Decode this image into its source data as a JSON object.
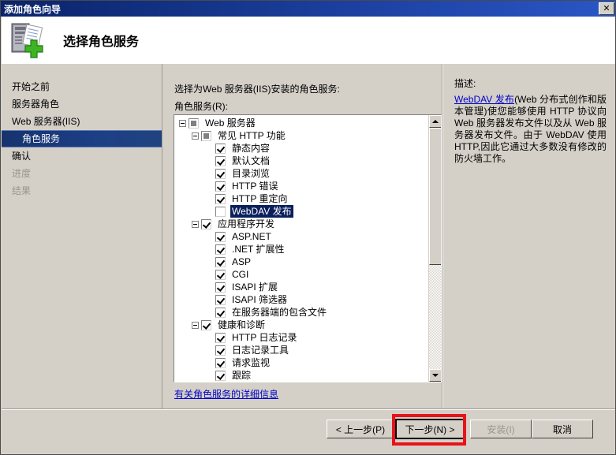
{
  "window": {
    "title": "添加角色向导",
    "close_label": "✕"
  },
  "header": {
    "title": "选择角色服务",
    "icon": "server-add-icon"
  },
  "sidebar": {
    "items": [
      {
        "label": "开始之前",
        "state": "normal",
        "indent": 0
      },
      {
        "label": "服务器角色",
        "state": "normal",
        "indent": 0
      },
      {
        "label": "Web 服务器(IIS)",
        "state": "normal",
        "indent": 0
      },
      {
        "label": "角色服务",
        "state": "selected",
        "indent": 1
      },
      {
        "label": "确认",
        "state": "normal",
        "indent": 0
      },
      {
        "label": "进度",
        "state": "disabled",
        "indent": 0
      },
      {
        "label": "结果",
        "state": "disabled",
        "indent": 0
      }
    ]
  },
  "main": {
    "instruction": "选择为Web 服务器(IIS)安装的角色服务:",
    "field_label": "角色服务(R):",
    "more_link": "有关角色服务的详细信息",
    "tree": [
      {
        "label": "Web 服务器",
        "indent": 0,
        "toggle": "expanded",
        "check": "partial",
        "selected": false
      },
      {
        "label": "常见 HTTP 功能",
        "indent": 1,
        "toggle": "expanded",
        "check": "partial",
        "selected": false
      },
      {
        "label": "静态内容",
        "indent": 2,
        "toggle": "none",
        "check": "checked",
        "selected": false
      },
      {
        "label": "默认文档",
        "indent": 2,
        "toggle": "none",
        "check": "checked",
        "selected": false
      },
      {
        "label": "目录浏览",
        "indent": 2,
        "toggle": "none",
        "check": "checked",
        "selected": false
      },
      {
        "label": "HTTP 错误",
        "indent": 2,
        "toggle": "none",
        "check": "checked",
        "selected": false
      },
      {
        "label": "HTTP 重定向",
        "indent": 2,
        "toggle": "none",
        "check": "checked",
        "selected": false
      },
      {
        "label": "WebDAV 发布",
        "indent": 2,
        "toggle": "none",
        "check": "unchecked",
        "selected": true
      },
      {
        "label": "应用程序开发",
        "indent": 1,
        "toggle": "expanded",
        "check": "checked",
        "selected": false
      },
      {
        "label": "ASP.NET",
        "indent": 2,
        "toggle": "none",
        "check": "checked",
        "selected": false
      },
      {
        "label": ".NET 扩展性",
        "indent": 2,
        "toggle": "none",
        "check": "checked",
        "selected": false
      },
      {
        "label": "ASP",
        "indent": 2,
        "toggle": "none",
        "check": "checked",
        "selected": false
      },
      {
        "label": "CGI",
        "indent": 2,
        "toggle": "none",
        "check": "checked",
        "selected": false
      },
      {
        "label": "ISAPI 扩展",
        "indent": 2,
        "toggle": "none",
        "check": "checked",
        "selected": false
      },
      {
        "label": "ISAPI 筛选器",
        "indent": 2,
        "toggle": "none",
        "check": "checked",
        "selected": false
      },
      {
        "label": "在服务器端的包含文件",
        "indent": 2,
        "toggle": "none",
        "check": "checked",
        "selected": false
      },
      {
        "label": "健康和诊断",
        "indent": 1,
        "toggle": "expanded",
        "check": "checked",
        "selected": false
      },
      {
        "label": "HTTP 日志记录",
        "indent": 2,
        "toggle": "none",
        "check": "checked",
        "selected": false
      },
      {
        "label": "日志记录工具",
        "indent": 2,
        "toggle": "none",
        "check": "checked",
        "selected": false
      },
      {
        "label": "请求监视",
        "indent": 2,
        "toggle": "none",
        "check": "checked",
        "selected": false
      },
      {
        "label": "跟踪",
        "indent": 2,
        "toggle": "none",
        "check": "checked",
        "selected": false
      }
    ],
    "scrollbar": {
      "thumb_top_pct": 0,
      "thumb_height_pct": 57
    }
  },
  "description": {
    "heading": "描述:",
    "link_text": "WebDAV 发布",
    "body": "(Web 分布式创作和版本管理)使您能够使用 HTTP 协议向 Web 服务器发布文件以及从 Web 服务器发布文件。由于 WebDAV 使用 HTTP,因此它通过大多数没有修改的防火墙工作。"
  },
  "footer": {
    "buttons": [
      {
        "label": "< 上一步(P)",
        "state": "normal"
      },
      {
        "label": "下一步(N) >",
        "state": "focused"
      },
      {
        "label": "安装(I)",
        "state": "disabled"
      },
      {
        "label": "取消",
        "state": "normal"
      }
    ]
  },
  "annotation": {
    "color": "#e8131a",
    "target": "下一步(N) >"
  }
}
